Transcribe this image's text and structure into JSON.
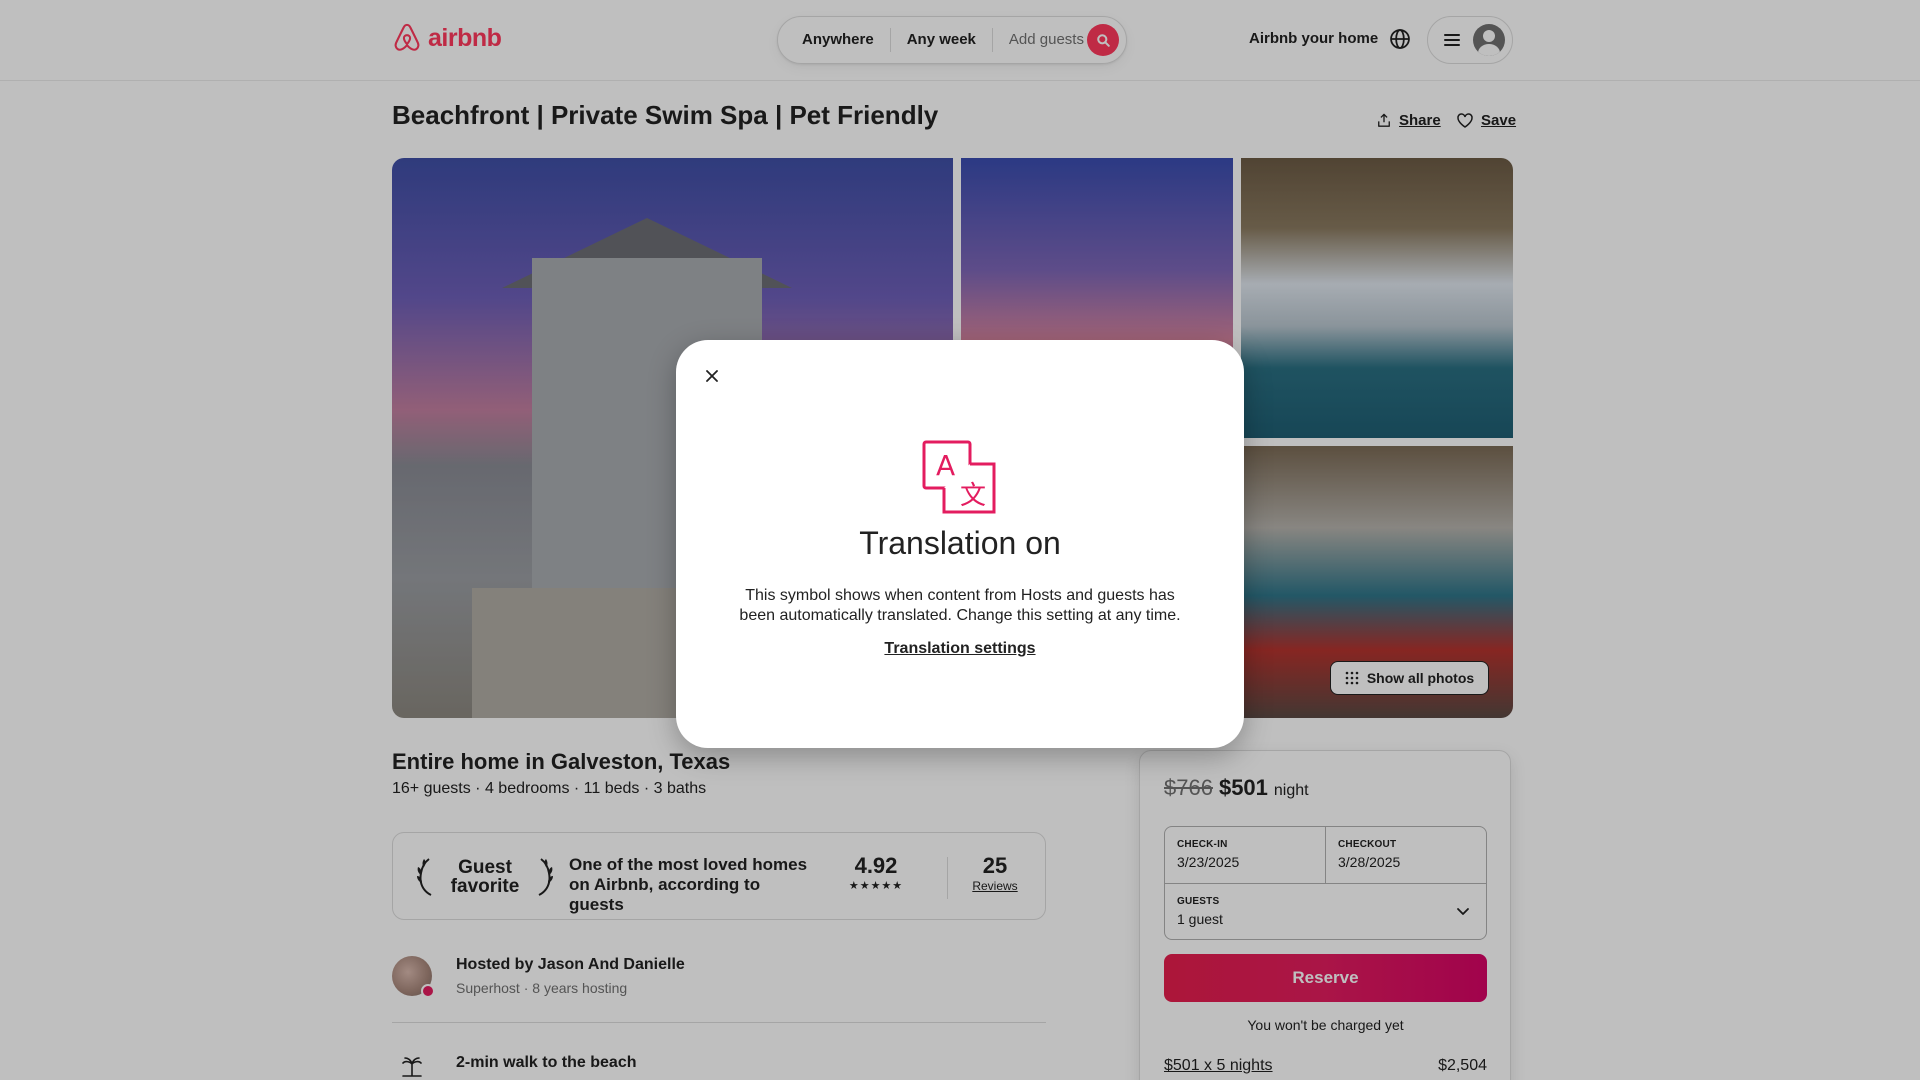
{
  "header": {
    "logo_text": "airbnb",
    "search": {
      "where": "Anywhere",
      "when": "Any week",
      "who": "Add guests"
    },
    "host_link": "Airbnb your home"
  },
  "listing": {
    "title": "Beachfront | Private Swim Spa | Pet Friendly",
    "share_label": "Share",
    "save_label": "Save",
    "show_all_photos": "Show all photos",
    "subtitle": "Entire home in Galveston, Texas",
    "details": "16+ guests · 4 bedrooms · 11 beds · 3 baths",
    "guest_favorite": {
      "badge_line1": "Guest",
      "badge_line2": "favorite",
      "description": "One of the most loved homes on Airbnb, according to guests",
      "rating": "4.92",
      "stars": "★★★★★",
      "reviews_count": "25",
      "reviews_label": "Reviews"
    },
    "host": {
      "hosted_by": "Hosted by Jason And Danielle",
      "sub": "Superhost · 8 years hosting"
    },
    "highlight": "2-min walk to the beach"
  },
  "booking": {
    "old_price": "$766",
    "new_price": "$501",
    "per_night": "night",
    "checkin_label": "CHECK-IN",
    "checkin_value": "3/23/2025",
    "checkout_label": "CHECKOUT",
    "checkout_value": "3/28/2025",
    "guests_label": "GUESTS",
    "guests_value": "1 guest",
    "reserve_label": "Reserve",
    "not_charged": "You won't be charged yet",
    "nights_label": "$501 x 5 nights",
    "nights_total": "$2,504"
  },
  "modal": {
    "title": "Translation on",
    "body": "This symbol shows when content from Hosts and guests has been automatically translated. Change this setting at any time.",
    "link": "Translation settings"
  },
  "colors": {
    "brand": "#FF385C",
    "reserve": "#E31C5F",
    "text": "#222222",
    "muted": "#717171",
    "overlay": "rgba(0,0,0,0.25)"
  },
  "icons": [
    "airbnb-logo-icon",
    "search-icon",
    "globe-icon",
    "menu-icon",
    "user-avatar-icon",
    "share-icon",
    "heart-icon",
    "grid-icon",
    "laurel-icon",
    "chevron-down-icon",
    "palm-tree-icon",
    "close-icon",
    "translate-icon"
  ]
}
